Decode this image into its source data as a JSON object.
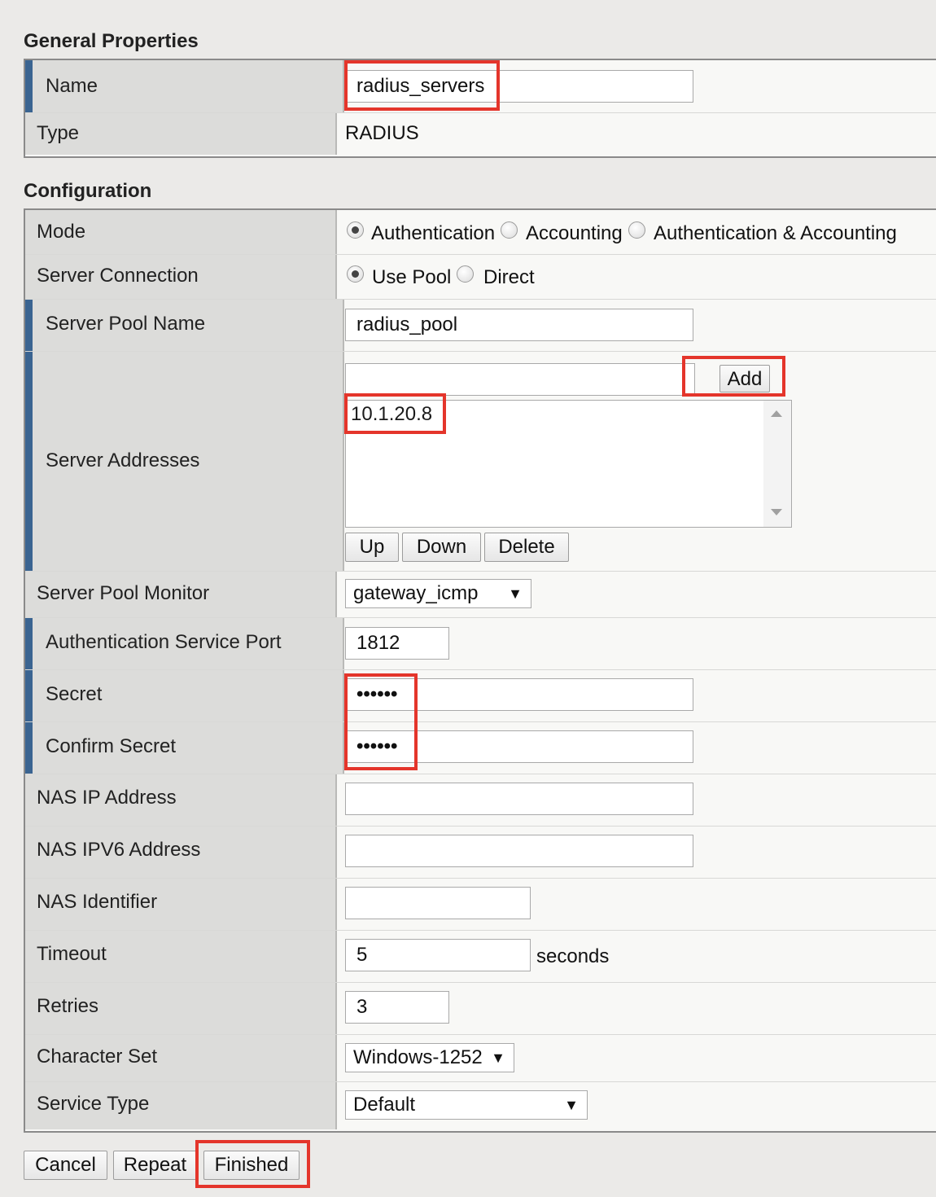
{
  "general": {
    "title": "General Properties",
    "name_label": "Name",
    "name_value": "radius_servers",
    "type_label": "Type",
    "type_value": "RADIUS"
  },
  "config": {
    "title": "Configuration",
    "mode": {
      "label": "Mode",
      "options": [
        "Authentication",
        "Accounting",
        "Authentication & Accounting"
      ],
      "selected": "Authentication"
    },
    "server_connection": {
      "label": "Server Connection",
      "options": [
        "Use Pool",
        "Direct"
      ],
      "selected": "Use Pool"
    },
    "server_pool_name": {
      "label": "Server Pool Name",
      "value": "radius_pool"
    },
    "server_addresses": {
      "label": "Server Addresses",
      "add_label": "Add",
      "input_value": "",
      "list": [
        "10.1.20.8"
      ],
      "up_label": "Up",
      "down_label": "Down",
      "delete_label": "Delete"
    },
    "server_pool_monitor": {
      "label": "Server Pool Monitor",
      "value": "gateway_icmp"
    },
    "auth_service_port": {
      "label": "Authentication Service Port",
      "value": "1812"
    },
    "secret": {
      "label": "Secret",
      "value": "••••••"
    },
    "confirm_secret": {
      "label": "Confirm Secret",
      "value": "••••••"
    },
    "nas_ip": {
      "label": "NAS IP Address",
      "value": ""
    },
    "nas_ipv6": {
      "label": "NAS IPV6 Address",
      "value": ""
    },
    "nas_identifier": {
      "label": "NAS Identifier",
      "value": ""
    },
    "timeout": {
      "label": "Timeout",
      "value": "5",
      "unit": "seconds"
    },
    "retries": {
      "label": "Retries",
      "value": "3"
    },
    "character_set": {
      "label": "Character Set",
      "value": "Windows-1252"
    },
    "service_type": {
      "label": "Service Type",
      "value": "Default"
    }
  },
  "actions": {
    "cancel": "Cancel",
    "repeat": "Repeat",
    "finished": "Finished"
  },
  "colors": {
    "required_marker": "#3a6491",
    "highlight": "#e4352b"
  },
  "icons": {
    "dropdown": "triangle-down-icon",
    "scroll_up": "scroll-up-arrow-icon",
    "scroll_down": "scroll-down-arrow-icon"
  }
}
